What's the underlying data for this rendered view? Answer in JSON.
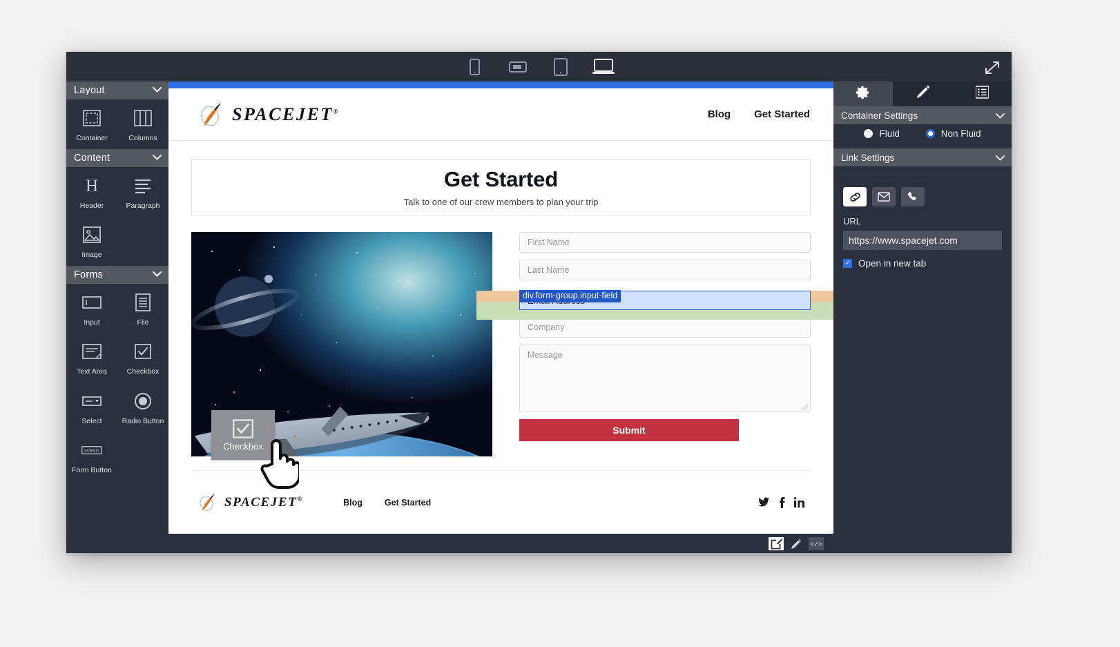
{
  "topbar": {
    "devices": [
      {
        "name": "mobile-portrait",
        "active": false
      },
      {
        "name": "mobile-landscape",
        "active": false
      },
      {
        "name": "tablet",
        "active": false
      },
      {
        "name": "desktop",
        "active": true
      }
    ],
    "expand_label": "Expand"
  },
  "sidebar": {
    "sections": [
      {
        "title": "Layout",
        "chevron": "⌄",
        "items": [
          {
            "label": "Container",
            "icon": "container-icon"
          },
          {
            "label": "Columns",
            "icon": "columns-icon"
          }
        ]
      },
      {
        "title": "Content",
        "chevron": "⌄",
        "items": [
          {
            "label": "Header",
            "icon": "heading-icon"
          },
          {
            "label": "Paragraph",
            "icon": "paragraph-icon"
          },
          {
            "label": "Image",
            "icon": "image-icon"
          }
        ]
      },
      {
        "title": "Forms",
        "chevron": "⌄",
        "items": [
          {
            "label": "Input",
            "icon": "input-icon"
          },
          {
            "label": "File",
            "icon": "file-icon"
          },
          {
            "label": "Text Area",
            "icon": "textarea-icon"
          },
          {
            "label": "Checkbox",
            "icon": "checkbox-icon"
          },
          {
            "label": "Select",
            "icon": "select-icon"
          },
          {
            "label": "Radio Button",
            "icon": "radio-icon"
          },
          {
            "label": "Form Button",
            "icon": "form-button-icon"
          }
        ]
      }
    ]
  },
  "drag": {
    "ghost_label": "Checkbox",
    "ghost_icon": "checkbox-icon"
  },
  "site": {
    "brand": {
      "name": "SPACEJET",
      "trademark": "®"
    },
    "nav": [
      "Blog",
      "Get Started"
    ],
    "hero": {
      "title": "Get Started",
      "subtitle": "Talk to one of our crew members to plan your trip"
    },
    "form": {
      "fields": [
        {
          "placeholder": "First Name",
          "type": "text"
        },
        {
          "placeholder": "Last Name",
          "type": "text"
        },
        {
          "placeholder": "Company",
          "type": "text"
        },
        {
          "placeholder": "Message",
          "type": "textarea"
        }
      ],
      "selected": {
        "tag": "div.form-group.input-field",
        "placeholder": "Email Address"
      },
      "submit_label": "Submit"
    },
    "footer": {
      "nav": [
        "Blog",
        "Get Started"
      ],
      "social": [
        {
          "name": "twitter-icon",
          "glyph": "🐦"
        },
        {
          "name": "facebook-icon",
          "glyph": "f"
        },
        {
          "name": "linkedin-icon",
          "glyph": "in"
        }
      ]
    }
  },
  "statusbar": {
    "buttons": [
      {
        "name": "edit-box-icon",
        "active": true
      },
      {
        "name": "pencil-icon",
        "active": false
      },
      {
        "name": "code-icon",
        "active": false
      }
    ]
  },
  "right_panel": {
    "tabs": [
      {
        "name": "settings-tab",
        "icon": "gear-icon",
        "active": true
      },
      {
        "name": "style-tab",
        "icon": "pencil-icon",
        "active": false
      },
      {
        "name": "list-tab",
        "icon": "list-icon",
        "active": false
      }
    ],
    "container_settings": {
      "title": "Container Settings",
      "chevron": "⌄",
      "options": [
        {
          "label": "Fluid",
          "selected": false
        },
        {
          "label": "Non Fluid",
          "selected": true
        }
      ]
    },
    "link_settings": {
      "title": "Link Settings",
      "chevron": "⌄",
      "types": [
        {
          "name": "link-icon",
          "active": true
        },
        {
          "name": "email-icon",
          "active": false
        },
        {
          "name": "phone-icon",
          "active": false
        }
      ],
      "url_label": "URL",
      "url_value": "https://www.spacejet.com",
      "new_tab_label": "Open in new tab",
      "new_tab_checked": true,
      "checkmark": "✓"
    }
  },
  "colors": {
    "accent_blue": "#2f6fe4",
    "panel_dark": "#2b313c",
    "section_head": "#54585f",
    "submit_red": "#c3303f",
    "selection_blue": "#2256c8",
    "highlight_orange": "#eec79b",
    "highlight_green": "#c9ddb7"
  }
}
